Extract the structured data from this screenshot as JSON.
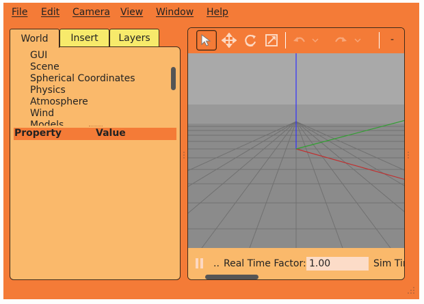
{
  "menubar": {
    "items": [
      "File",
      "Edit",
      "Camera",
      "View",
      "Window",
      "Help"
    ]
  },
  "left_panel": {
    "tabs": [
      {
        "label": "World",
        "active": true
      },
      {
        "label": "Insert",
        "active": false
      },
      {
        "label": "Layers",
        "active": false
      }
    ],
    "tree_items": [
      "GUI",
      "Scene",
      "Spherical Coordinates",
      "Physics",
      "Atmosphere",
      "Wind",
      "Models"
    ],
    "property_header": {
      "property": "Property",
      "value": "Value"
    }
  },
  "toolbar": {
    "tools": [
      {
        "icon": "select-arrow-icon",
        "active": true
      },
      {
        "icon": "translate-icon",
        "active": false
      },
      {
        "icon": "rotate-icon",
        "active": false
      },
      {
        "icon": "scale-icon",
        "active": false
      },
      {
        "icon": "undo-icon",
        "active": false
      },
      {
        "icon": "undo-dropdown-icon",
        "active": false
      },
      {
        "icon": "redo-icon",
        "active": false
      },
      {
        "icon": "redo-dropdown-icon",
        "active": false
      }
    ],
    "overflow_label": "-"
  },
  "bottom_bar": {
    "step_label": "..",
    "real_time_factor_label": "Real Time Factor:",
    "real_time_factor_value": "1.00",
    "sim_time_label": "Sim Time"
  },
  "colors": {
    "window_bg": "#f47b37",
    "panel_bg": "#fab96b",
    "inactive_tab_bg": "#f7ea6b",
    "viewport_sky": "#a9a9a9",
    "viewport_ground": "#8d8d8d",
    "axis_z": "#3030ff",
    "axis_x": "#c03030",
    "axis_y": "#30a030"
  }
}
